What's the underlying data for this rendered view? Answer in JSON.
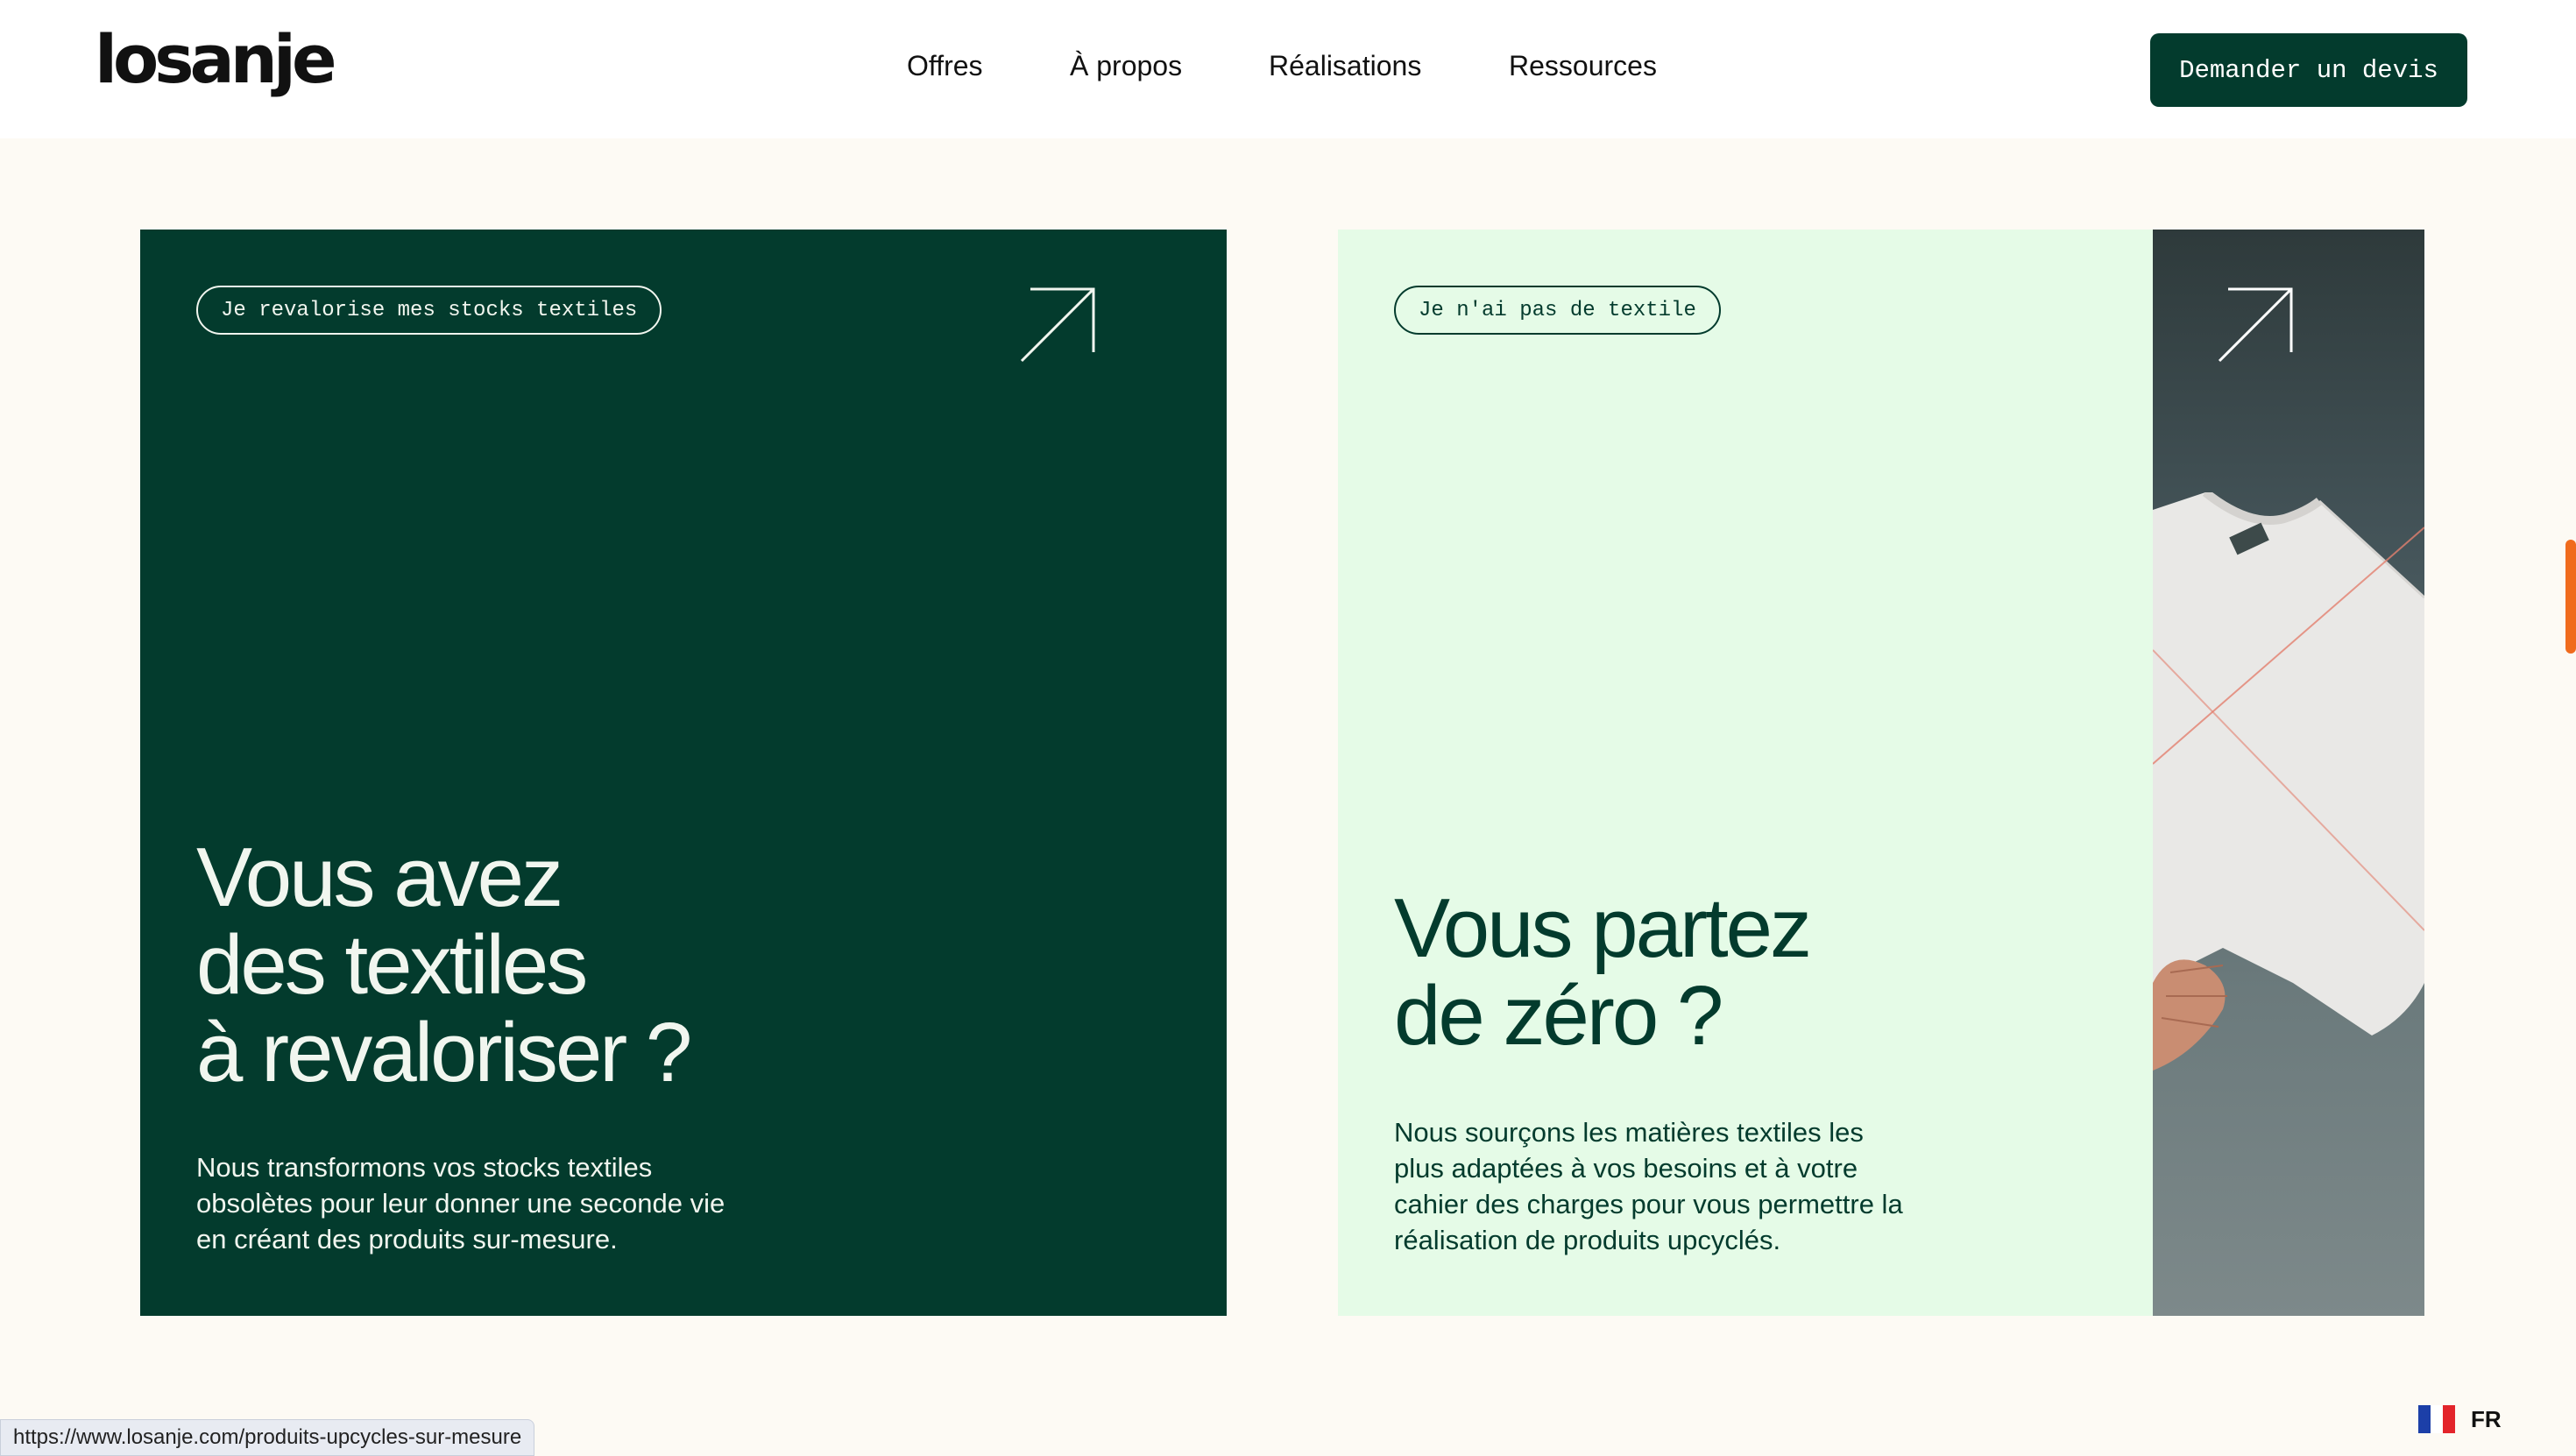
{
  "brand": {
    "logo_text": "losanje"
  },
  "nav": {
    "items": [
      {
        "label": "Offres"
      },
      {
        "label": "À propos"
      },
      {
        "label": "Réalisations"
      },
      {
        "label": "Ressources"
      }
    ]
  },
  "header": {
    "cta_label": "Demander un devis"
  },
  "cards": [
    {
      "tag": "Je revalorise mes stocks textiles",
      "headline_lines": [
        "Vous avez",
        "des textiles",
        "à revaloriser ?"
      ],
      "body_lines": [
        "Nous transformons vos stocks textiles",
        "obsolètes pour leur donner une seconde vie",
        "en créant des produits sur-mesure."
      ]
    },
    {
      "tag": "Je n'ai pas de textile",
      "headline_lines": [
        "Vous partez",
        "de zéro ?"
      ],
      "body_lines": [
        "Nous sourçons les matières textiles les",
        "plus adaptées à vos besoins et à votre",
        "cahier des charges pour vous permettre la",
        "réalisation de produits upcyclés."
      ]
    }
  ],
  "status_bar": {
    "url": "https://www.losanje.com/produits-upcycles-sur-mesure"
  },
  "language": {
    "label": "FR",
    "flag_icon": "france-flag-icon"
  },
  "colors": {
    "dark_green": "#033b2d",
    "mint": "#e5fbe7",
    "cream": "#fdfaf4",
    "accent_orange": "#f06b1d"
  }
}
